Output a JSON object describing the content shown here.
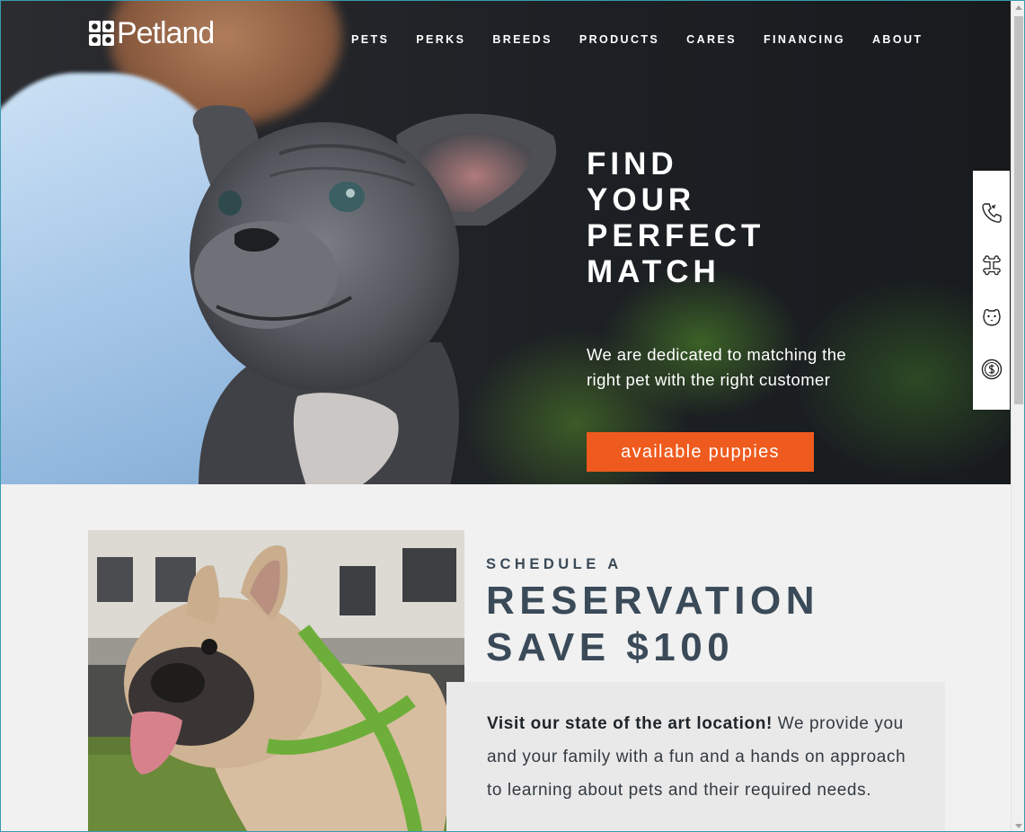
{
  "brand": {
    "name": "Petland",
    "logo_icon": "paw-logo-icon"
  },
  "nav": {
    "items": [
      {
        "label": "PETS"
      },
      {
        "label": "PERKS"
      },
      {
        "label": "BREEDS"
      },
      {
        "label": "PRODUCTS"
      },
      {
        "label": "CARES"
      },
      {
        "label": "FINANCING"
      },
      {
        "label": "ABOUT"
      }
    ]
  },
  "hero": {
    "title_lines": [
      "FIND",
      "YOUR",
      "PERFECT",
      "MATCH"
    ],
    "subtitle": "We are dedicated to matching the right pet with the right customer",
    "cta_label": "available puppies",
    "cta_color": "#ef5b1e"
  },
  "sidebar": {
    "icons": [
      "phone-icon",
      "bone-icon",
      "puppy-face-icon",
      "dollar-coin-icon"
    ]
  },
  "reservation": {
    "kicker": "SCHEDULE A",
    "headline_lines": [
      "RESERVATION",
      "SAVE $100"
    ],
    "body_bold": "Visit our state of the art location!",
    "body_text": " We provide you and your family with a fun and a hands on approach to learning about pets and their required needs.",
    "heading_color": "#3a4a58"
  }
}
